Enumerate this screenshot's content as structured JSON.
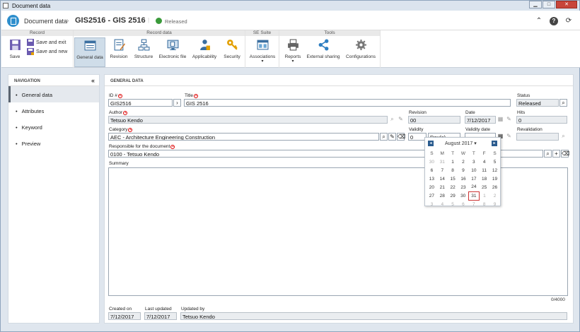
{
  "window": {
    "title": "Document data"
  },
  "header": {
    "breadcrumb": "Document data",
    "title": "GIS2516 - GIS 2516",
    "status": "Released"
  },
  "ribbon": {
    "groups": {
      "record": "Record",
      "record_data": "Record data",
      "se_suite": "SE Suite",
      "tools": "Tools"
    },
    "save": "Save",
    "save_exit": "Save and exit",
    "save_new": "Save and new",
    "general_data": "General data",
    "revision": "Revision",
    "structure": "Structure",
    "electronic_file": "Electronic file",
    "applicability": "Applicability",
    "security": "Security",
    "associations": "Associations",
    "reports": "Reports",
    "external_sharing": "External sharing",
    "configurations": "Configurations"
  },
  "nav": {
    "title": "NAVIGATION",
    "items": [
      "General data",
      "Attributes",
      "Keyword",
      "Preview"
    ]
  },
  "main": {
    "title": "GENERAL DATA"
  },
  "form": {
    "id_label": "ID #",
    "id_value": "GIS2516",
    "title_label": "Title",
    "title_value": "GIS 2516",
    "status_label": "Status",
    "status_value": "Released",
    "author_label": "Author",
    "author_value": "Tetsuo Kendo",
    "revision_label": "Revision",
    "revision_value": "00",
    "date_label": "Date",
    "date_value": "7/12/2017",
    "hits_label": "Hits",
    "hits_value": "0",
    "category_label": "Category",
    "category_value": "AEC - Architecture Engineering Construction",
    "validity_label": "Validity",
    "validity_value": "0",
    "validity_unit": "Day(s)",
    "validity_date_label": "Validity date",
    "revalidation_label": "Revalidation",
    "responsible_label": "Responsible for the document",
    "responsible_value": "0100 - Tetsuo Kendo",
    "summary_label": "Summary",
    "summary_count": "0/4000",
    "created_label": "Created on",
    "created_value": "7/12/2017",
    "updated_label": "Last updated",
    "updated_value": "7/12/2017",
    "updated_by_label": "Updated by",
    "updated_by_value": "Tetsuo Kendo"
  },
  "calendar": {
    "month": "August 2017",
    "weekdays": [
      "S",
      "M",
      "T",
      "W",
      "T",
      "F",
      "S"
    ],
    "weeks": [
      [
        "30",
        "31",
        "1",
        "2",
        "3",
        "4",
        "5"
      ],
      [
        "6",
        "7",
        "8",
        "9",
        "10",
        "11",
        "12"
      ],
      [
        "13",
        "14",
        "15",
        "16",
        "17",
        "18",
        "19"
      ],
      [
        "20",
        "21",
        "22",
        "23",
        "24",
        "25",
        "26"
      ],
      [
        "27",
        "28",
        "29",
        "30",
        "31",
        "1",
        "2"
      ],
      [
        "3",
        "4",
        "5",
        "6",
        "7",
        "8",
        "9"
      ]
    ]
  }
}
